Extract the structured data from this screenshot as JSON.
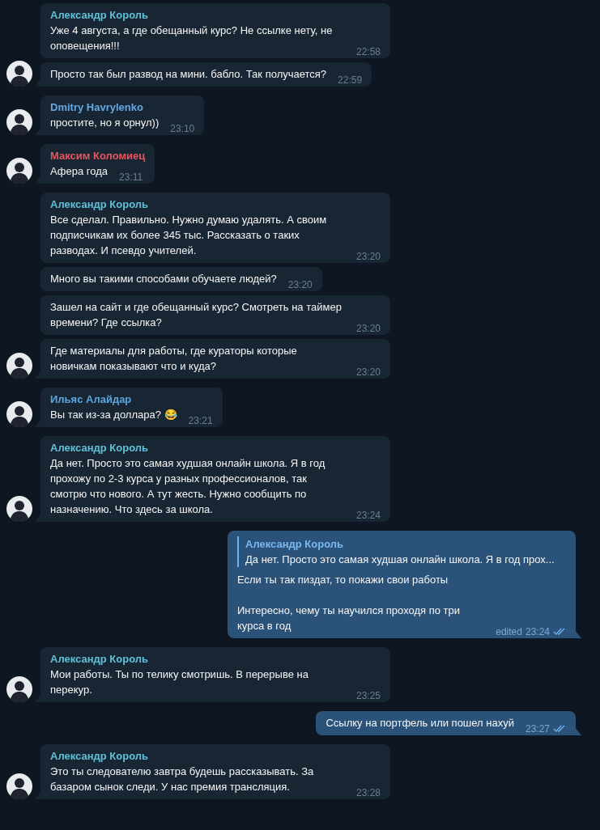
{
  "groups": [
    {
      "kind": "incoming",
      "sender": "Александр Король",
      "color": "#5fc1d8",
      "messages": [
        {
          "text": "Уже 4 августа, а где обещанный курс? Не ссылке нету, не оповещения!!!",
          "time": "22:58"
        },
        {
          "text": "Просто так был развод на мини. бабло. Так получается?",
          "time": "22:59"
        }
      ]
    },
    {
      "kind": "incoming",
      "sender": "Dmitry Havrylenko",
      "color": "#62a9e3",
      "messages": [
        {
          "text": "простите, но я орнул))",
          "time": "23:10"
        }
      ]
    },
    {
      "kind": "incoming",
      "sender": "Максим Коломиец",
      "color": "#e5575f",
      "messages": [
        {
          "text": "Афера года",
          "time": "23:11"
        }
      ]
    },
    {
      "kind": "incoming",
      "sender": "Александр Король",
      "color": "#5fc1d8",
      "messages": [
        {
          "text": "Все сделал. Правильно. Нужно думаю удалять. А своим подписчикам их более 345 тыс. Рассказать о таких разводах. И псевдо учителей.",
          "time": "23:20"
        },
        {
          "text": "Много вы такими способами обучаете людей?",
          "time": "23:20"
        },
        {
          "text": "Зашел на сайт и где обещанный курс? Смотреть на таймер времени? Где ссылка?",
          "time": "23:20"
        },
        {
          "text": "Где материалы для работы, где кураторы которые новичкам показывают что и куда?",
          "time": "23:20"
        }
      ]
    },
    {
      "kind": "incoming",
      "sender": "Ильяс Алайдар",
      "color": "#5aa6e0",
      "messages": [
        {
          "text": "Вы так из-за доллара? 😂",
          "time": "23:21"
        }
      ]
    },
    {
      "kind": "incoming",
      "sender": "Александр Король",
      "color": "#5fc1d8",
      "messages": [
        {
          "text": "Да нет. Просто это самая худшая онлайн школа. Я в год прохожу по 2-3 курса у разных профессионалов, так смотрю что нового. А тут жесть. Нужно сообщить по назначению. Что здесь за школа.",
          "time": "23:24"
        }
      ]
    },
    {
      "kind": "outgoing",
      "messages": [
        {
          "reply": {
            "sender": "Александр Король",
            "text": "Да нет. Просто это самая худшая онлайн школа. Я в год прох..."
          },
          "paragraphs": [
            "Если ты так пиздат, то покажи свои работы",
            "Интересно, чему ты научился проходя по три курса в год"
          ],
          "edited_label": "edited",
          "time": "23:24",
          "read": true
        }
      ]
    },
    {
      "kind": "incoming",
      "sender": "Александр Король",
      "color": "#5fc1d8",
      "messages": [
        {
          "text": "Мои работы. Ты по телику смотришь. В перерыве на перекур.",
          "time": "23:25"
        }
      ]
    },
    {
      "kind": "outgoing",
      "messages": [
        {
          "paragraphs": [
            "Ссылку на портфель или пошел нахуй"
          ],
          "time": "23:27",
          "read": true
        }
      ]
    },
    {
      "kind": "incoming",
      "sender": "Александр Король",
      "color": "#5fc1d8",
      "messages": [
        {
          "text": "Это ты следователю завтра будешь рассказывать. За базаром сынок следи. У нас премия трансляция.",
          "time": "23:28"
        }
      ]
    }
  ]
}
